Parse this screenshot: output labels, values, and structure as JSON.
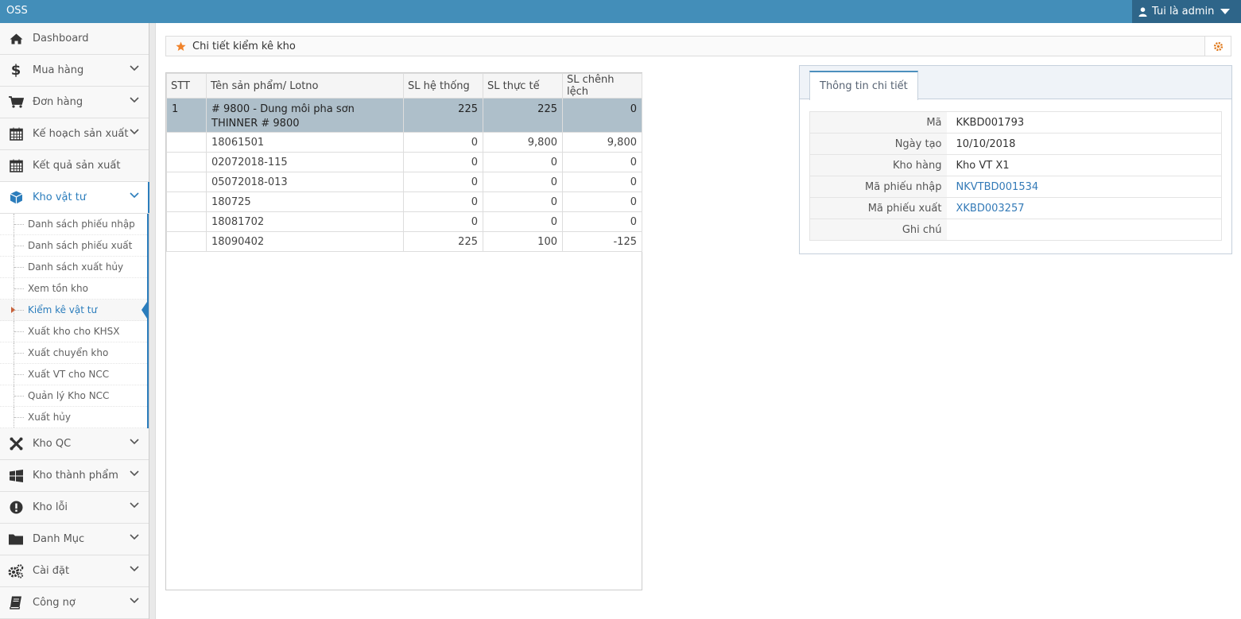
{
  "app": {
    "brand": "OSS",
    "user_label": "Tui là admin"
  },
  "sidebar": {
    "items": [
      {
        "label": "Dashboard",
        "icon": "home-icon"
      },
      {
        "label": "Mua hàng",
        "icon": "dollar-icon"
      },
      {
        "label": "Đơn hàng",
        "icon": "cart-icon"
      },
      {
        "label": "Kế hoạch sản xuất",
        "icon": "calendar-icon"
      },
      {
        "label": "Kết quả sản xuất",
        "icon": "calendar-icon"
      },
      {
        "label": "Kho vật tư",
        "icon": "cube-icon"
      }
    ],
    "submenu": [
      "Danh sách phiếu nhập",
      "Danh sách phiếu xuất",
      "Danh sách xuất hủy",
      "Xem tồn kho",
      "Kiểm kê vật tư",
      "Xuất kho cho KHSX",
      "Xuất chuyển kho",
      "Xuất VT cho NCC",
      "Quản lý Kho NCC",
      "Xuất hủy"
    ],
    "items_after": [
      {
        "label": "Kho QC",
        "icon": "joomla-icon"
      },
      {
        "label": "Kho thành phẩm",
        "icon": "windows-icon"
      },
      {
        "label": "Kho lỗi",
        "icon": "exclamation-icon"
      },
      {
        "label": "Danh Mục",
        "icon": "folder-icon"
      },
      {
        "label": "Cài đặt",
        "icon": "cogs-icon"
      },
      {
        "label": "Công nợ",
        "icon": "book-icon"
      }
    ]
  },
  "page": {
    "title": "Chi tiết kiểm kê kho"
  },
  "table": {
    "headers": [
      "STT",
      "Tên sản phẩm/ Lotno",
      "SL hệ thống",
      "SL thực tế",
      "SL chênh lệch"
    ],
    "group": {
      "stt": "1",
      "name": "# 9800 - Dung môi pha sơn THINNER # 9800",
      "system": "225",
      "actual": "225",
      "diff": "0"
    },
    "rows": [
      {
        "lot": "18061501",
        "system": "0",
        "actual": "9,800",
        "diff": "9,800"
      },
      {
        "lot": "02072018-115",
        "system": "0",
        "actual": "0",
        "diff": "0"
      },
      {
        "lot": "05072018-013",
        "system": "0",
        "actual": "0",
        "diff": "0"
      },
      {
        "lot": "180725",
        "system": "0",
        "actual": "0",
        "diff": "0"
      },
      {
        "lot": "18081702",
        "system": "0",
        "actual": "0",
        "diff": "0"
      },
      {
        "lot": "18090402",
        "system": "225",
        "actual": "100",
        "diff": "-125"
      }
    ]
  },
  "detail": {
    "tab_label": "Thông tin chi tiết",
    "fields": [
      {
        "key": "Mã",
        "value": "KKBD001793"
      },
      {
        "key": "Ngày tạo",
        "value": "10/10/2018"
      },
      {
        "key": "Kho hàng",
        "value": "Kho VT X1"
      },
      {
        "key": "Mã phiếu nhập",
        "value": "NKVTBD001534"
      },
      {
        "key": "Mã phiếu xuất",
        "value": "XKBD003257"
      },
      {
        "key": "Ghi chú",
        "value": ""
      }
    ]
  },
  "colors": {
    "topbar": "#438eb9",
    "user_box": "#2e6589",
    "accent": "#2b7dbc",
    "group_row": "#aebfca",
    "star": "#f0832b"
  }
}
